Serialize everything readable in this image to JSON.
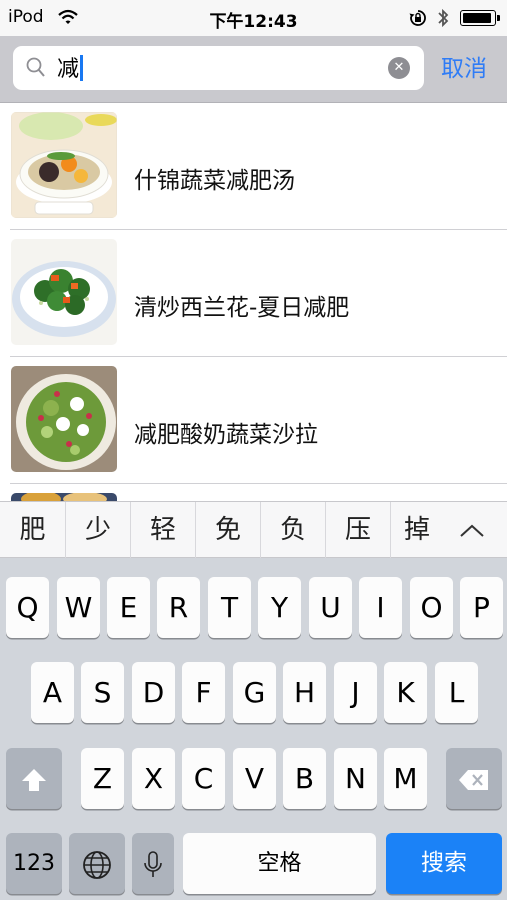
{
  "status_bar": {
    "carrier": "iPod",
    "time": "下午12:43",
    "battery_level": 0.95
  },
  "search": {
    "query": "减",
    "cancel_label": "取消"
  },
  "results": [
    {
      "title": "什锦蔬菜减肥汤",
      "thumb": "soup"
    },
    {
      "title": "清炒西兰花-夏日减肥",
      "thumb": "broccoli"
    },
    {
      "title": "减肥酸奶蔬菜沙拉",
      "thumb": "salad"
    },
    {
      "title": "",
      "thumb": "partial"
    }
  ],
  "candidates": [
    "肥",
    "少",
    "轻",
    "免",
    "负",
    "压",
    "掉"
  ],
  "keyboard": {
    "row1": [
      "Q",
      "W",
      "E",
      "R",
      "T",
      "Y",
      "U",
      "I",
      "O",
      "P"
    ],
    "row2": [
      "A",
      "S",
      "D",
      "F",
      "G",
      "H",
      "J",
      "K",
      "L"
    ],
    "row3": [
      "Z",
      "X",
      "C",
      "V",
      "B",
      "N",
      "M"
    ],
    "numbers_label": "123",
    "space_label": "空格",
    "search_label": "搜索"
  },
  "icons": {
    "wifi": "wifi-icon",
    "rotation_lock": "rotation-lock-icon",
    "bluetooth": "bluetooth-icon",
    "search": "search-icon",
    "clear": "clear-icon",
    "expand": "chevron-up-icon",
    "shift": "shift-icon",
    "globe": "globe-icon",
    "mic": "microphone-icon",
    "delete": "delete-icon"
  },
  "colors": {
    "accent": "#2f7cf6",
    "search_key": "#1b82f7"
  }
}
